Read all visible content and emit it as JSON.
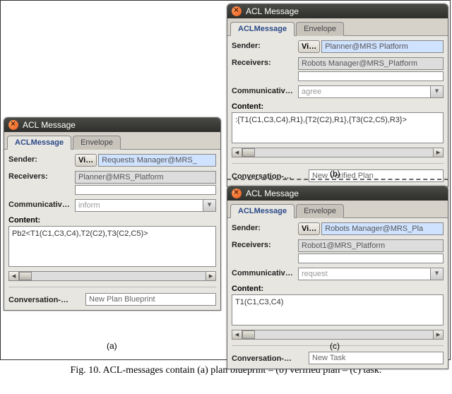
{
  "window_title": "ACL Message",
  "tabs": {
    "msg": "ACLMessage",
    "env": "Envelope"
  },
  "labels": {
    "sender": "Sender:",
    "receivers": "Receivers:",
    "communicative": "Communicativ…",
    "content": "Content:",
    "conversation": "Conversation-…",
    "view_btn": "Vi…"
  },
  "panels": {
    "a": {
      "sender": "Requests Manager@MRS_",
      "receivers": "Planner@MRS_Platform",
      "communicative": "inform",
      "content": "Pb2<T1(C1,C3,C4),T2(C2),T3(C2,C5)>",
      "conversation": "New Plan Blueprint",
      "label": "(a)"
    },
    "b": {
      "sender": "Planner@MRS Platform",
      "receivers": "Robots Manager@MRS_Platform",
      "communicative": "agree",
      "content": ":{T1(C1,C3,C4),R1},{T2(C2),R1},{T3(C2,C5),R3}>",
      "conversation": "New Verified Plan",
      "label": "(b)"
    },
    "c": {
      "sender": "Robots Manager@MRS_Pla",
      "receivers": "Robot1@MRS_Platform",
      "communicative": "request",
      "content": "T1(C1,C3,C4)",
      "conversation": "New Task",
      "label": "(c)"
    }
  },
  "caption": "Fig. 10.   ACL-messages contain (a) plan blueprint – (b) verified plan – (c) task."
}
